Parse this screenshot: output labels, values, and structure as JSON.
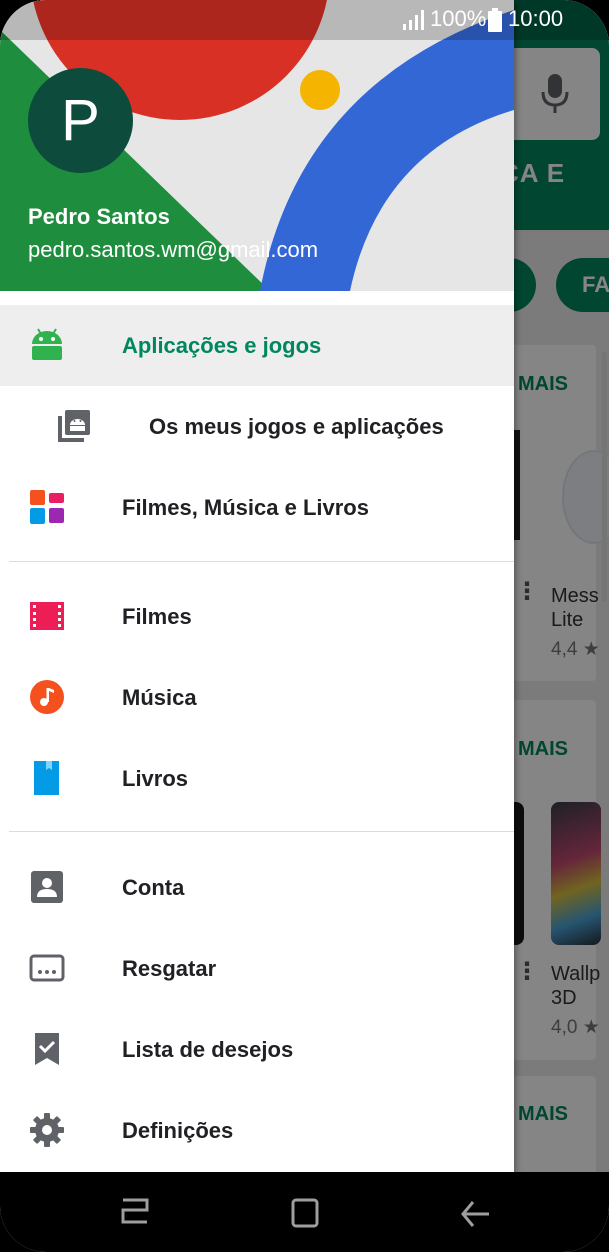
{
  "status_bar": {
    "battery": "100%",
    "time": "10:00"
  },
  "background": {
    "tab_partial": "CA E",
    "chip_partial": "FA",
    "more_label": "MAIS",
    "apps": [
      {
        "name": "Mess Lite",
        "rating": "4,4 ★"
      },
      {
        "name": "Wallp 3D",
        "rating": "4,0 ★"
      }
    ]
  },
  "account": {
    "initial": "P",
    "name": "Pedro Santos",
    "email": "pedro.santos.wm@gmail.com"
  },
  "menu": {
    "apps_games": "Aplicações e jogos",
    "my_apps": "Os meus jogos e aplicações",
    "movies_music_books": "Filmes, Música e Livros",
    "movies": "Filmes",
    "music": "Música",
    "books": "Livros",
    "account": "Conta",
    "redeem": "Resgatar",
    "wishlist": "Lista de desejos",
    "settings": "Definições"
  },
  "colors": {
    "accent": "#01875f",
    "header_red": "#d93025",
    "header_blue": "#3367d6",
    "header_green": "#1e8e3e",
    "header_yellow": "#f4b400"
  }
}
